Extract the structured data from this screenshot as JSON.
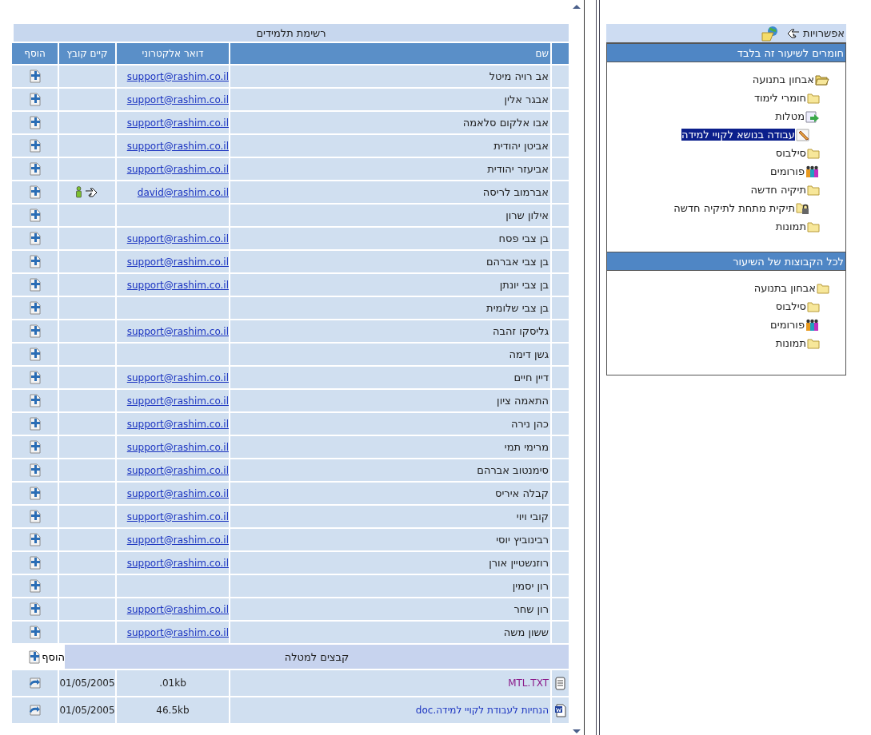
{
  "students_table": {
    "title": "רשימת תלמידים",
    "columns": [
      "שם",
      "דואר אלקטרוני",
      "קיים קובץ",
      "הוסף"
    ],
    "rows": [
      {
        "name": "אב רויה מיטל",
        "email": "support@rashim.co.il",
        "file_exists": false
      },
      {
        "name": "אבגר אלין",
        "email": "support@rashim.co.il",
        "file_exists": false
      },
      {
        "name": "אבו אלקום סלאמה",
        "email": "support@rashim.co.il",
        "file_exists": false
      },
      {
        "name": "אביטן יהודית",
        "email": "support@rashim.co.il",
        "file_exists": false
      },
      {
        "name": "אביעזר יהודית",
        "email": "support@rashim.co.il",
        "file_exists": false
      },
      {
        "name": "אברמוב לריסה",
        "email": "david@rashim.co.il",
        "file_exists": true
      },
      {
        "name": "אילון שרון",
        "file_exists": false
      },
      {
        "name": "בן צבי פסח",
        "email": "support@rashim.co.il",
        "file_exists": false
      },
      {
        "name": "בן צבי אברהם",
        "email": "support@rashim.co.il",
        "file_exists": false
      },
      {
        "name": "בן צבי יונתן",
        "email": "support@rashim.co.il",
        "file_exists": false
      },
      {
        "name": "בן צבי שלומית",
        "file_exists": false
      },
      {
        "name": "גליסקו זהבה",
        "email": "support@rashim.co.il",
        "file_exists": false
      },
      {
        "name": "גשן דימה",
        "file_exists": false
      },
      {
        "name": "דיין חיים",
        "email": "support@rashim.co.il",
        "file_exists": false
      },
      {
        "name": "התאמה ציון",
        "email": "support@rashim.co.il",
        "file_exists": false
      },
      {
        "name": "כהן נירה",
        "email": "support@rashim.co.il",
        "file_exists": false
      },
      {
        "name": "מרימי תמי",
        "email": "support@rashim.co.il",
        "file_exists": false
      },
      {
        "name": "סימנטוב אברהם",
        "email": "support@rashim.co.il",
        "file_exists": false
      },
      {
        "name": "קבלה איריס",
        "email": "support@rashim.co.il",
        "file_exists": false
      },
      {
        "name": "קובי ויוי",
        "email": "support@rashim.co.il",
        "file_exists": false
      },
      {
        "name": "רבינוביץ יוסי",
        "email": "support@rashim.co.il",
        "file_exists": false
      },
      {
        "name": "רוזנשטיין אורן",
        "email": "support@rashim.co.il",
        "file_exists": false
      },
      {
        "name": "רון יסמין",
        "file_exists": false
      },
      {
        "name": "רון שחר",
        "email": "support@rashim.co.il",
        "file_exists": false
      },
      {
        "name": "ששון משה",
        "email": "support@rashim.co.il",
        "file_exists": false
      }
    ]
  },
  "files_section": {
    "title": "קבצים למטלה",
    "add_label": "הוסף",
    "files": [
      {
        "kind": "text",
        "name": "MTL.TXT",
        "visited": true,
        "size": ".01kb",
        "date": "01/05/2005"
      },
      {
        "kind": "word",
        "name": "הנחיות לעבודת לקויי למידה.doc",
        "visited": false,
        "size": "46.5kb",
        "date": "01/05/2005"
      }
    ]
  },
  "options_panel": {
    "title": "אפשרויות",
    "sections": [
      {
        "title": "חומרים לשיעור זה בלבד",
        "tree": [
          {
            "label": "אבחון בתנועה",
            "kind": "open-folder",
            "selected": false,
            "children": [
              {
                "label": "חומרי לימוד",
                "kind": "folder",
                "selected": false
              },
              {
                "label": "מטלות",
                "kind": "assignments",
                "selected": false,
                "children": [
                  {
                    "label": "עבודה בנושא לקויי למידה",
                    "kind": "assignment",
                    "selected": true
                  }
                ]
              },
              {
                "label": "סילבוס",
                "kind": "folder",
                "selected": false
              },
              {
                "label": "פורומים",
                "kind": "forum",
                "selected": false
              },
              {
                "label": "תיקיה חדשה",
                "kind": "folder",
                "selected": false,
                "children": [
                  {
                    "label": "תיקית מתחת לתיקיה חדשה",
                    "kind": "locked-folder",
                    "selected": false
                  }
                ]
              },
              {
                "label": "תמונות",
                "kind": "folder",
                "selected": false
              }
            ]
          }
        ]
      },
      {
        "title": "לכל הקבוצות של השיעור",
        "tree": [
          {
            "label": "אבחון בתנועה",
            "kind": "folder",
            "selected": false,
            "children": [
              {
                "label": "סילבוס",
                "kind": "folder",
                "selected": false
              },
              {
                "label": "פורומים",
                "kind": "forum",
                "selected": false
              },
              {
                "label": "תמונות",
                "kind": "folder",
                "selected": false
              }
            ]
          }
        ]
      }
    ]
  }
}
